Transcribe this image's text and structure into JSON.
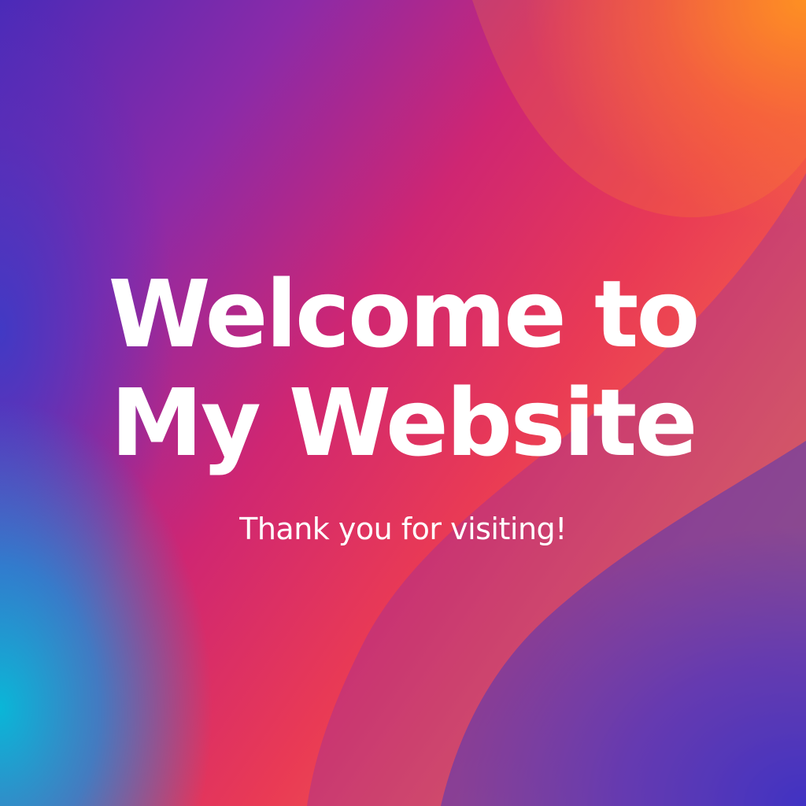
{
  "hero": {
    "title_line1": "Welcome to",
    "title_line2": "My Website",
    "subtitle": "Thank you for visiting!"
  },
  "colors": {
    "text": "#ffffff",
    "gradient_blue": "#3a3ac8",
    "gradient_cyan": "#10b4d8",
    "gradient_purple": "#8b2aa8",
    "gradient_pink": "#d8286e",
    "gradient_red": "#ee3c52",
    "gradient_orange": "#fb8a2e"
  }
}
